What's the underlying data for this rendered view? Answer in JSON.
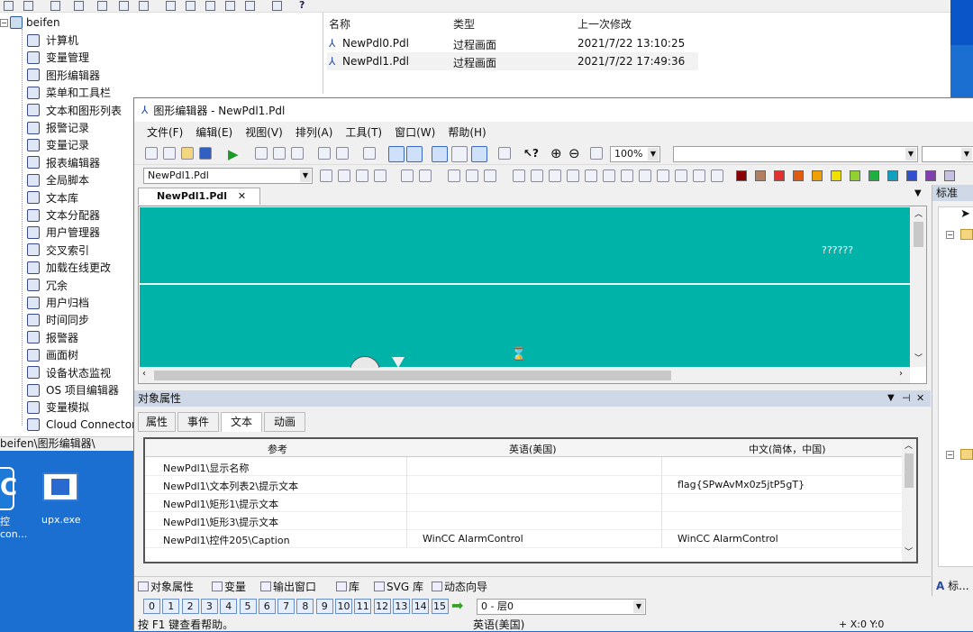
{
  "explorer": {
    "root_label": "beifen",
    "tree_items": [
      {
        "label": "计算机",
        "icon": "computer-icon"
      },
      {
        "label": "变量管理",
        "icon": "tag-management-icon"
      },
      {
        "label": "图形编辑器",
        "icon": "graphics-designer-icon"
      },
      {
        "label": "菜单和工具栏",
        "icon": "menu-toolbar-icon"
      },
      {
        "label": "文本和图形列表",
        "icon": "text-graphic-list-icon"
      },
      {
        "label": "报警记录",
        "icon": "alarm-logging-icon"
      },
      {
        "label": "变量记录",
        "icon": "tag-logging-icon"
      },
      {
        "label": "报表编辑器",
        "icon": "report-designer-icon"
      },
      {
        "label": "全局脚本",
        "icon": "global-script-icon"
      },
      {
        "label": "文本库",
        "icon": "text-library-icon"
      },
      {
        "label": "文本分配器",
        "icon": "text-distributor-icon"
      },
      {
        "label": "用户管理器",
        "icon": "user-administrator-icon"
      },
      {
        "label": "交叉索引",
        "icon": "cross-reference-icon"
      },
      {
        "label": "加载在线更改",
        "icon": "load-online-changes-icon"
      },
      {
        "label": "冗余",
        "icon": "redundancy-icon"
      },
      {
        "label": "用户归档",
        "icon": "user-archive-icon"
      },
      {
        "label": "时间同步",
        "icon": "time-sync-icon"
      },
      {
        "label": "报警器",
        "icon": "horn-icon"
      },
      {
        "label": "画面树",
        "icon": "picture-tree-icon"
      },
      {
        "label": "设备状态监视",
        "icon": "device-status-icon"
      },
      {
        "label": "OS 项目编辑器",
        "icon": "os-project-editor-icon"
      },
      {
        "label": "变量模拟",
        "icon": "tag-simulator-icon"
      },
      {
        "label": "Cloud Connector",
        "icon": "cloud-connector-icon"
      }
    ],
    "status_path": "beifen\\图形编辑器\\",
    "list_headers": [
      "名称",
      "类型",
      "上一次修改"
    ],
    "files": [
      {
        "name": "NewPdl0.Pdl",
        "type": "过程画面",
        "modified": "2021/7/22 13:10:25"
      },
      {
        "name": "NewPdl1.Pdl",
        "type": "过程画面",
        "modified": "2021/7/22 17:49:36"
      }
    ]
  },
  "desktop": {
    "icons": [
      {
        "label": "控",
        "label2": "con..."
      },
      {
        "label": "upx.exe"
      }
    ]
  },
  "editor": {
    "title": "图形编辑器 - NewPdl1.Pdl",
    "menu": [
      "文件(F)",
      "编辑(E)",
      "视图(V)",
      "排列(A)",
      "工具(T)",
      "窗口(W)",
      "帮助(H)"
    ],
    "zoom": "100%",
    "object_combo": "NewPdl1.Pdl",
    "colors": [
      "#8b0000",
      "#b08060",
      "#e03030",
      "#e05a10",
      "#f0a000",
      "#f0e000",
      "#90d030",
      "#20b040",
      "#10a0c0",
      "#3050d0",
      "#8040b0",
      "#c8c0e0"
    ],
    "doc_tab": "NewPdl1.Pdl",
    "canvas_text": "??????",
    "props": {
      "title": "对象属性",
      "tabs": [
        "属性",
        "事件",
        "文本",
        "动画"
      ],
      "selected_tab": "文本",
      "headers": [
        "参考",
        "英语(美国)",
        "中文(简体，中国)"
      ],
      "rows": [
        {
          "ref": "NewPdl1\\显示名称",
          "en": "",
          "zh": ""
        },
        {
          "ref": "NewPdl1\\文本列表2\\提示文本",
          "en": "",
          "zh": "flag{SPwAvMx0z5jtP5gT}"
        },
        {
          "ref": "NewPdl1\\矩形1\\提示文本",
          "en": "",
          "zh": ""
        },
        {
          "ref": "NewPdl1\\矩形3\\提示文本",
          "en": "",
          "zh": ""
        },
        {
          "ref": "NewPdl1\\控件205\\Caption",
          "en": "WinCC AlarmControl",
          "zh": "WinCC AlarmControl"
        }
      ]
    },
    "bottom_tabs": [
      "对象属性",
      "变量",
      "输出窗口",
      "库",
      "SVG 库",
      "动态向导"
    ],
    "layers": [
      "0",
      "1",
      "2",
      "3",
      "4",
      "5",
      "6",
      "7",
      "8",
      "9",
      "10",
      "11",
      "12",
      "13",
      "14",
      "15"
    ],
    "layer_combo": "0 - 层0",
    "status_help": "按 F1 键查看帮助。",
    "status_lang": "英语(美国)",
    "status_coords": "X:0 Y:0",
    "std_panel_title": "标准",
    "std_panel_bottom": "标..."
  }
}
